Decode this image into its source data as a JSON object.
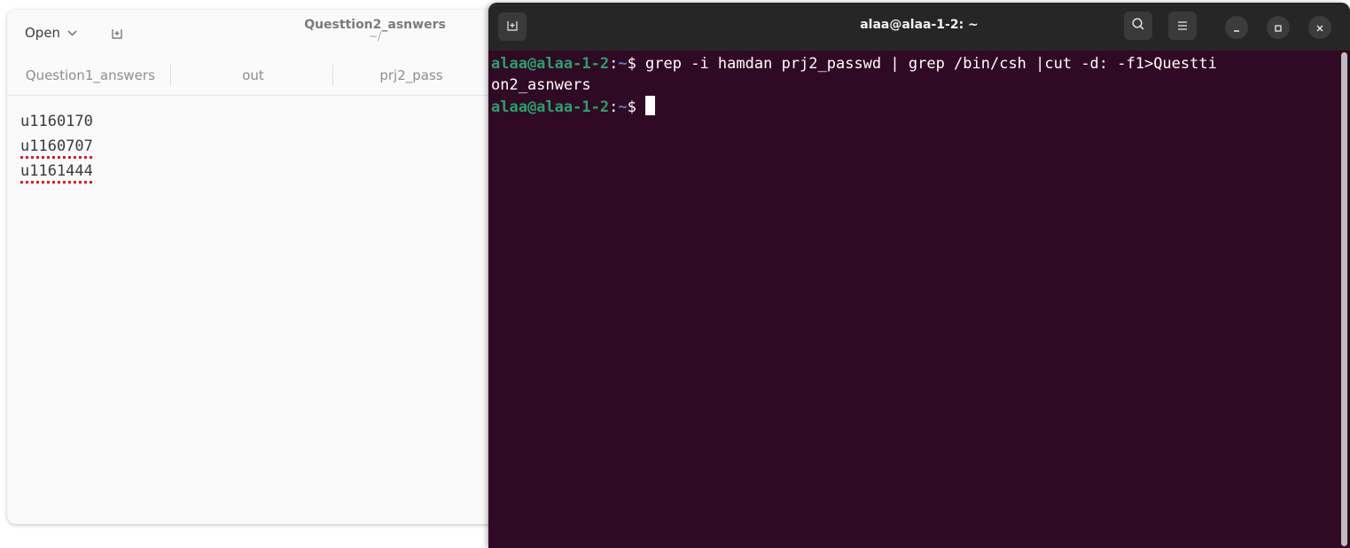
{
  "editor": {
    "open_label": "Open",
    "title": "Questtion2_asnwers",
    "subtitle": "~/",
    "tabs": [
      {
        "label": "Question1_answers"
      },
      {
        "label": "out"
      },
      {
        "label": "prj2_pass"
      }
    ],
    "lines": [
      "u1160170",
      "u1160707",
      "u1161444"
    ]
  },
  "terminal": {
    "title": "alaa@alaa-1-2: ~",
    "prompt_user": "alaa@alaa-1-2",
    "prompt_colon": ":",
    "prompt_path": "~",
    "prompt_dollar": "$ ",
    "command_line1": "grep -i hamdan prj2_passwd | grep /bin/csh |cut -d: -f1>Questti",
    "command_line2": "on2_asnwers",
    "colors": {
      "background": "#300a24",
      "user": "#26a269",
      "path": "#5a7fd8"
    }
  }
}
